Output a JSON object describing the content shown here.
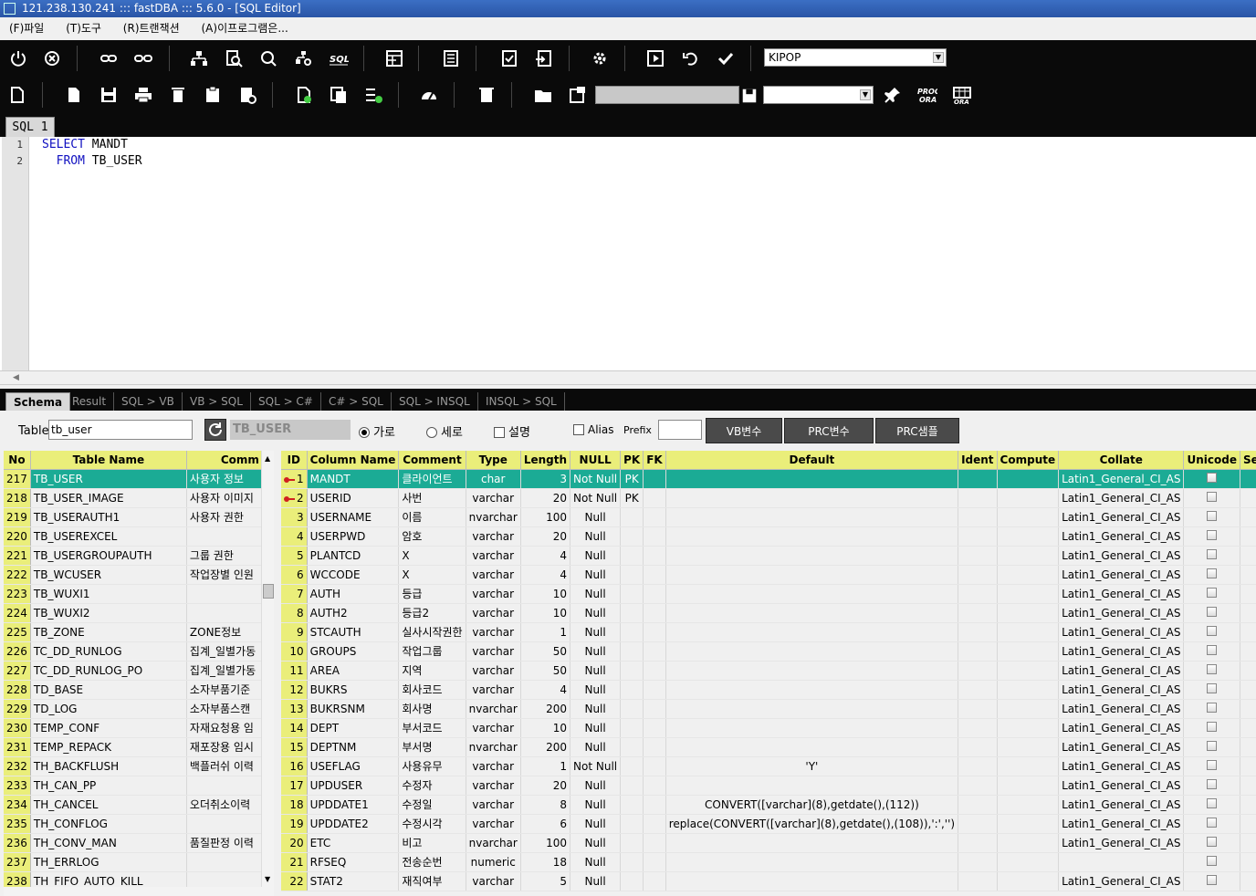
{
  "window": {
    "title": "121.238.130.241 ::: fastDBA ::: 5.6.0 - [SQL Editor]"
  },
  "menu": [
    "(F)파일",
    "(T)도구",
    "(R)트랜잭션",
    "(A)이프로그램은..."
  ],
  "toolbar": {
    "db_combo": "KIPOP",
    "save_path": "",
    "combo2": ""
  },
  "sql_tab": "SQL 1",
  "editor": {
    "line_numbers": [
      "1",
      "2"
    ],
    "line1_kw": "SELECT",
    "line1_rest": " MANDT",
    "line2_kw": "  FROM",
    "line2_rest": " TB_USER"
  },
  "bottom_tabs": [
    "Schema",
    "Result",
    "SQL > VB",
    "VB > SQL",
    "SQL > C#",
    "C# > SQL",
    "SQL > INSQL",
    "INSQL > SQL"
  ],
  "schema_bar": {
    "table_label": "Table",
    "table_value": "tb_user",
    "table_display": "TB_USER",
    "radio_horizontal": "가로",
    "radio_vertical": "세로",
    "check_desc": "설명",
    "check_alias": "Alias",
    "prefix_label": "Prefix",
    "prefix_value": "",
    "btn_vb": "VB변수",
    "btn_prc": "PRC변수",
    "btn_sample": "PRC샘플"
  },
  "table_list": {
    "headers": [
      "No",
      "Table Name",
      "Comm"
    ],
    "rows": [
      [
        "217",
        "TB_USER",
        "사용자 정보"
      ],
      [
        "218",
        "TB_USER_IMAGE",
        "사용자 이미지"
      ],
      [
        "219",
        "TB_USERAUTH1",
        "사용자 권한"
      ],
      [
        "220",
        "TB_USEREXCEL",
        ""
      ],
      [
        "221",
        "TB_USERGROUPAUTH",
        "그룹 권한"
      ],
      [
        "222",
        "TB_WCUSER",
        "작업장별 인원"
      ],
      [
        "223",
        "TB_WUXI1",
        ""
      ],
      [
        "224",
        "TB_WUXI2",
        ""
      ],
      [
        "225",
        "TB_ZONE",
        "ZONE정보"
      ],
      [
        "226",
        "TC_DD_RUNLOG",
        "집계_일별가동"
      ],
      [
        "227",
        "TC_DD_RUNLOG_PO",
        "집계_일별가동"
      ],
      [
        "228",
        "TD_BASE",
        "소자부품기준"
      ],
      [
        "229",
        "TD_LOG",
        "소자부품스캔"
      ],
      [
        "230",
        "TEMP_CONF",
        "자재요청용 임"
      ],
      [
        "231",
        "TEMP_REPACK",
        "재포장용 임시"
      ],
      [
        "232",
        "TH_BACKFLUSH",
        "백플러쉬 이력"
      ],
      [
        "233",
        "TH_CAN_PP",
        ""
      ],
      [
        "234",
        "TH_CANCEL",
        "오더취소이력"
      ],
      [
        "235",
        "TH_CONFLOG",
        ""
      ],
      [
        "236",
        "TH_CONV_MAN",
        "품질판정 이력"
      ],
      [
        "237",
        "TH_ERRLOG",
        ""
      ],
      [
        "238",
        "TH_FIFO_AUTO_KILL",
        ""
      ]
    ]
  },
  "columns": {
    "headers": [
      "ID",
      "Column Name",
      "Comment",
      "Type",
      "Length",
      "NULL",
      "PK",
      "FK",
      "Default",
      "Ident",
      "Compute",
      "Collate",
      "Unicode",
      "Set PK"
    ],
    "rows": [
      [
        "1",
        "MANDT",
        "클라이언트",
        "char",
        "3",
        "Not Null",
        "PK",
        "",
        "",
        "",
        "",
        "Latin1_General_CI_AS"
      ],
      [
        "2",
        "USERID",
        "사번",
        "varchar",
        "20",
        "Not Null",
        "PK",
        "",
        "",
        "",
        "",
        "Latin1_General_CI_AS"
      ],
      [
        "3",
        "USERNAME",
        "이름",
        "nvarchar",
        "100",
        "Null",
        "",
        "",
        "",
        "",
        "",
        "Latin1_General_CI_AS"
      ],
      [
        "4",
        "USERPWD",
        "암호",
        "varchar",
        "20",
        "Null",
        "",
        "",
        "",
        "",
        "",
        "Latin1_General_CI_AS"
      ],
      [
        "5",
        "PLANTCD",
        "X",
        "varchar",
        "4",
        "Null",
        "",
        "",
        "",
        "",
        "",
        "Latin1_General_CI_AS"
      ],
      [
        "6",
        "WCCODE",
        "X",
        "varchar",
        "4",
        "Null",
        "",
        "",
        "",
        "",
        "",
        "Latin1_General_CI_AS"
      ],
      [
        "7",
        "AUTH",
        "등급",
        "varchar",
        "10",
        "Null",
        "",
        "",
        "",
        "",
        "",
        "Latin1_General_CI_AS"
      ],
      [
        "8",
        "AUTH2",
        "등급2",
        "varchar",
        "10",
        "Null",
        "",
        "",
        "",
        "",
        "",
        "Latin1_General_CI_AS"
      ],
      [
        "9",
        "STCAUTH",
        "실사시작권한",
        "varchar",
        "1",
        "Null",
        "",
        "",
        "",
        "",
        "",
        "Latin1_General_CI_AS"
      ],
      [
        "10",
        "GROUPS",
        "작업그룹",
        "varchar",
        "50",
        "Null",
        "",
        "",
        "",
        "",
        "",
        "Latin1_General_CI_AS"
      ],
      [
        "11",
        "AREA",
        "지역",
        "varchar",
        "50",
        "Null",
        "",
        "",
        "",
        "",
        "",
        "Latin1_General_CI_AS"
      ],
      [
        "12",
        "BUKRS",
        "회사코드",
        "varchar",
        "4",
        "Null",
        "",
        "",
        "",
        "",
        "",
        "Latin1_General_CI_AS"
      ],
      [
        "13",
        "BUKRSNM",
        "회사명",
        "nvarchar",
        "200",
        "Null",
        "",
        "",
        "",
        "",
        "",
        "Latin1_General_CI_AS"
      ],
      [
        "14",
        "DEPT",
        "부서코드",
        "varchar",
        "10",
        "Null",
        "",
        "",
        "",
        "",
        "",
        "Latin1_General_CI_AS"
      ],
      [
        "15",
        "DEPTNM",
        "부서명",
        "nvarchar",
        "200",
        "Null",
        "",
        "",
        "",
        "",
        "",
        "Latin1_General_CI_AS"
      ],
      [
        "16",
        "USEFLAG",
        "사용유무",
        "varchar",
        "1",
        "Not Null",
        "",
        "",
        "'Y'",
        "",
        "",
        "Latin1_General_CI_AS"
      ],
      [
        "17",
        "UPDUSER",
        "수정자",
        "varchar",
        "20",
        "Null",
        "",
        "",
        "",
        "",
        "",
        "Latin1_General_CI_AS"
      ],
      [
        "18",
        "UPDDATE1",
        "수정일",
        "varchar",
        "8",
        "Null",
        "",
        "",
        "CONVERT([varchar](8),getdate(),(112))",
        "",
        "",
        "Latin1_General_CI_AS"
      ],
      [
        "19",
        "UPDDATE2",
        "수정시각",
        "varchar",
        "6",
        "Null",
        "",
        "",
        "replace(CONVERT([varchar](8),getdate(),(108)),':','')",
        "",
        "",
        "Latin1_General_CI_AS"
      ],
      [
        "20",
        "ETC",
        "비고",
        "nvarchar",
        "100",
        "Null",
        "",
        "",
        "",
        "",
        "",
        "Latin1_General_CI_AS"
      ],
      [
        "21",
        "RFSEQ",
        "전송순번",
        "numeric",
        "18",
        "Null",
        "",
        "",
        "",
        "",
        "",
        ""
      ],
      [
        "22",
        "STAT2",
        "재직여부",
        "varchar",
        "5",
        "Null",
        "",
        "",
        "",
        "",
        "",
        "Latin1_General_CI_AS"
      ]
    ]
  }
}
